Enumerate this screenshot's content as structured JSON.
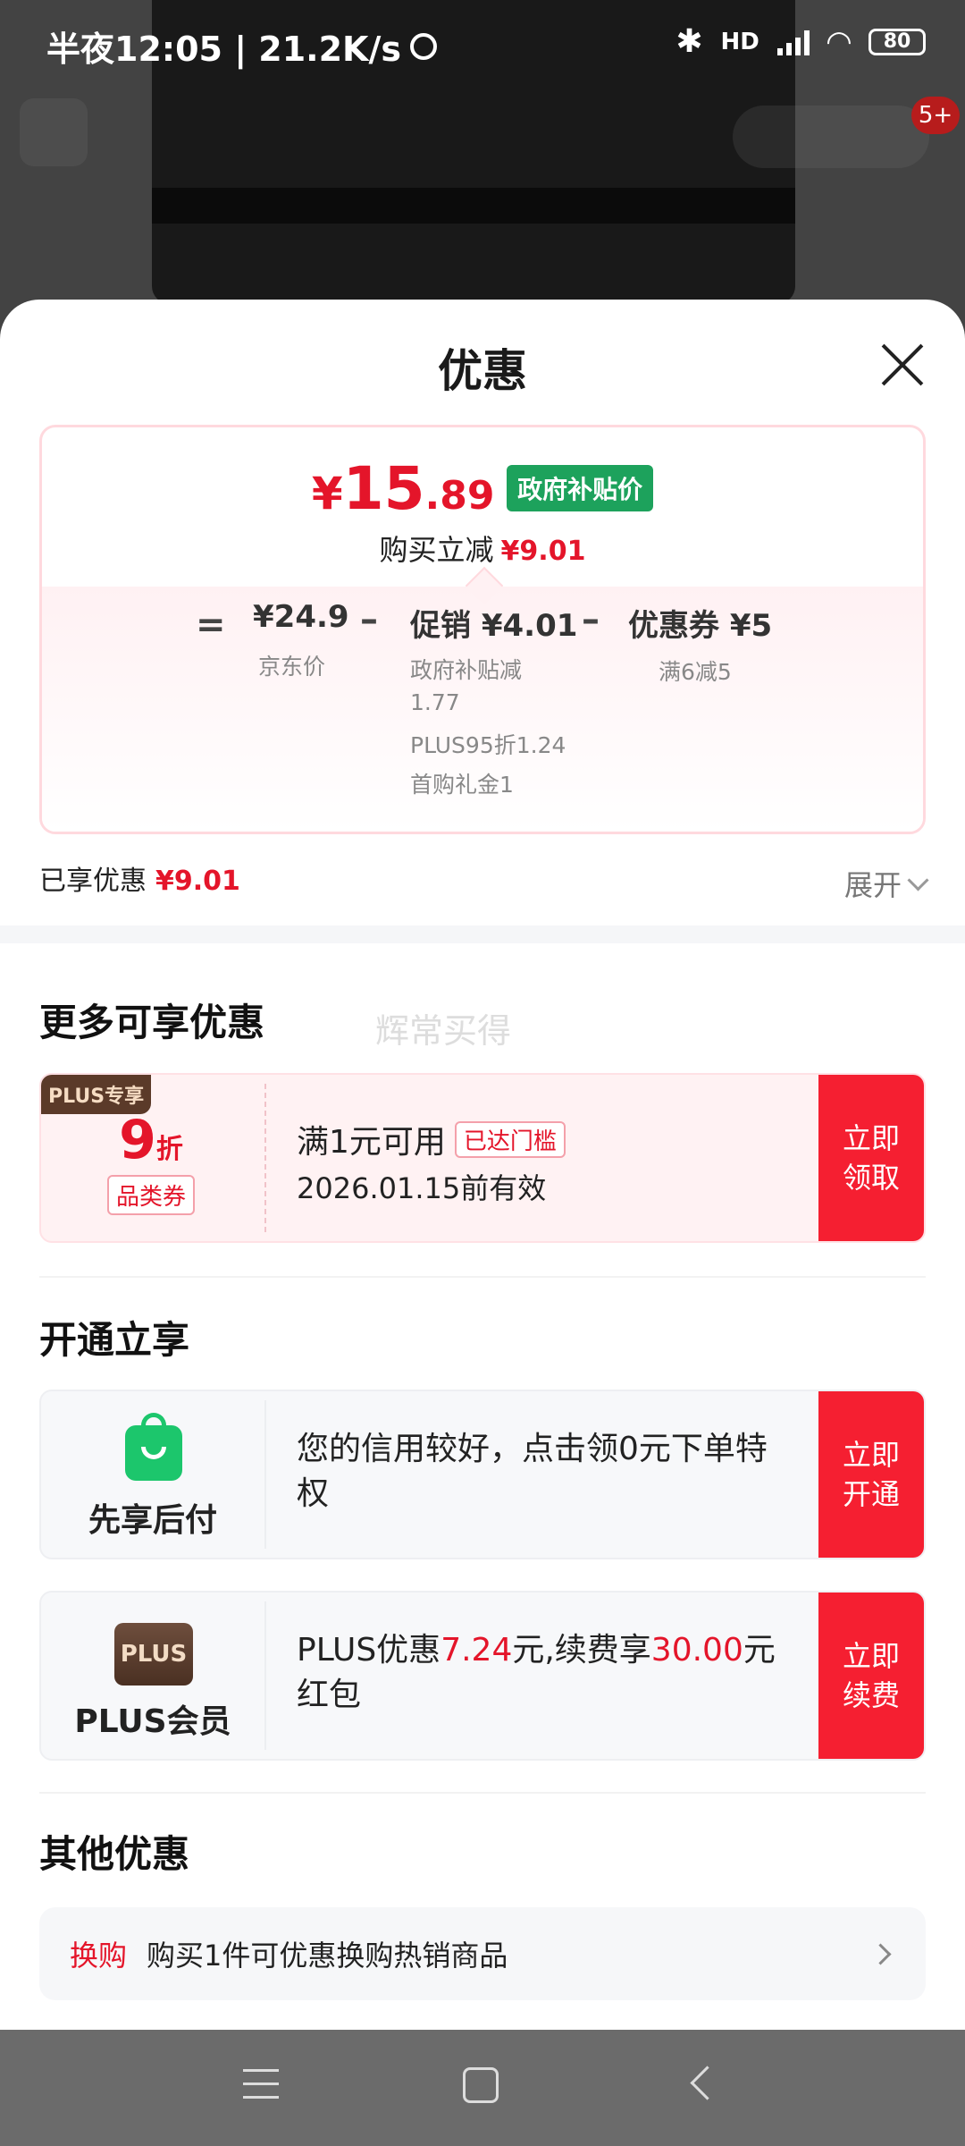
{
  "status_bar": {
    "time": "半夜12:05 | 21.2K/s",
    "hd": "HD",
    "battery": "80"
  },
  "background": {
    "cart_badge": "5+"
  },
  "sheet": {
    "title": "优惠",
    "price": {
      "currency": "¥",
      "integer": "15",
      "decimal": ".89",
      "tag": "政府补贴价",
      "save_label": "购买立减",
      "save_value": "¥9.01"
    },
    "breakdown": {
      "eq": "=",
      "minus": "–",
      "jd_price": "¥24.9",
      "jd_label": "京东价",
      "promo": "促销 ¥4.01",
      "promo_details": [
        "政府补贴减",
        "1.77",
        "PLUS95折1.24",
        "首购礼金1"
      ],
      "coupon": "优惠券 ¥5",
      "coupon_detail": "满6减5"
    },
    "enjoyed_label": "已享优惠",
    "enjoyed_value": "¥9.01",
    "expand_label": "展开"
  },
  "more_section": {
    "title": "更多可享优惠",
    "watermark": "辉常买得",
    "coupon": {
      "plus_tag": "PLUS专享",
      "discount": "9",
      "discount_unit": "折",
      "category": "品类券",
      "condition": "满1元可用",
      "reached": "已达门槛",
      "expiry": "2026.01.15前有效",
      "button": "立即\n领取"
    }
  },
  "open_section": {
    "title": "开通立享",
    "pay_later": {
      "name": "先享后付",
      "desc": "您的信用较好，点击领0元下单特权",
      "button": "立即\n开通"
    },
    "plus": {
      "logo": "PLUS",
      "name": "PLUS会员",
      "desc_1": "PLUS优惠",
      "desc_2": "7.24",
      "desc_3": "元,续费享",
      "desc_4": "30.00",
      "desc_5": "元红包",
      "button": "立即\n续费"
    }
  },
  "other_section": {
    "title": "其他优惠",
    "swap_tag": "换购",
    "swap_text": "购买1件可优惠换购热销商品"
  },
  "colors": {
    "accent_red": "#e4152a",
    "button_red": "#f51f31",
    "green_tag": "#1da25c"
  }
}
